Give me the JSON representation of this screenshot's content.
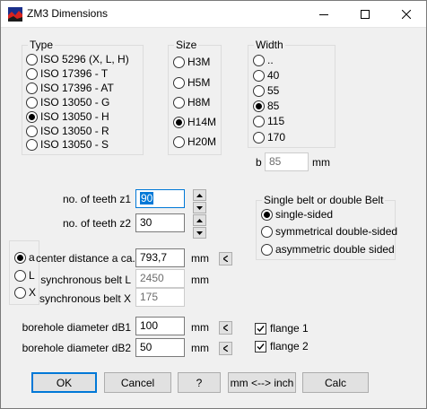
{
  "window": {
    "title": "ZM3 Dimensions",
    "icon": "app-icon",
    "controls": [
      "minimize-icon",
      "maximize-icon",
      "close-icon"
    ]
  },
  "type": {
    "label": "Type",
    "options": [
      "ISO 5296 (X, L, H)",
      "ISO 17396 - T",
      "ISO 17396 - AT",
      "ISO 13050 - G",
      "ISO 13050 - H",
      "ISO 13050 - R",
      "ISO 13050 - S"
    ],
    "selected": "ISO 13050 - H"
  },
  "size": {
    "label": "Size",
    "options": [
      "H3M",
      "H5M",
      "H8M",
      "H14M",
      "H20M"
    ],
    "selected": "H14M"
  },
  "width": {
    "label": "Width",
    "options": [
      "..",
      "40",
      "55",
      "85",
      "115",
      "170"
    ],
    "selected": "85",
    "b_label": "b",
    "b_value": "85",
    "b_unit": "mm"
  },
  "teeth": {
    "z1_label": "no. of teeth z1",
    "z1_value": "90",
    "z2_label": "no. of teeth z2",
    "z2_value": "30"
  },
  "belt": {
    "label": "Single belt or double Belt",
    "options": [
      "single-sided",
      "symmetrical double-sided",
      "asymmetric double sided"
    ],
    "selected": "single-sided"
  },
  "calc_mode": {
    "options": [
      "a",
      "L",
      "X"
    ],
    "selected": "a"
  },
  "distance": {
    "center_label": "center distance a ca.",
    "center_value": "793,7",
    "center_unit": "mm",
    "belt_l_label": "synchronous belt L",
    "belt_l_value": "2450",
    "belt_l_unit": "mm",
    "belt_x_label": "synchronous belt X",
    "belt_x_value": "175"
  },
  "borehole": {
    "db1_label": "borehole diameter dB1",
    "db1_value": "100",
    "db1_unit": "mm",
    "db2_label": "borehole diameter dB2",
    "db2_value": "50",
    "db2_unit": "mm"
  },
  "flanges": {
    "flange1_label": "flange 1",
    "flange1_checked": true,
    "flange2_label": "flange 2",
    "flange2_checked": true
  },
  "buttons": {
    "ok": "OK",
    "cancel": "Cancel",
    "help": "?",
    "units": "mm <--> inch",
    "calc": "Calc"
  }
}
